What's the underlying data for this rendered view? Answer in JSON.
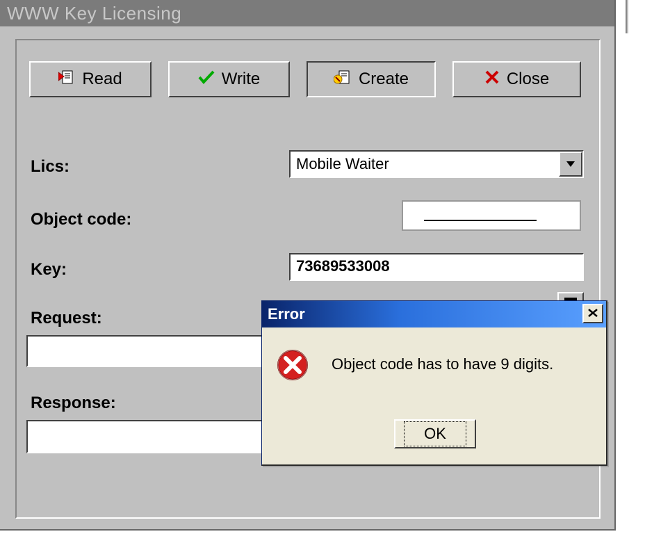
{
  "window": {
    "title": "WWW Key Licensing"
  },
  "toolbar": {
    "read_label": "Read",
    "write_label": "Write",
    "create_label": "Create",
    "close_label": "Close"
  },
  "fields": {
    "lics_label": "Lics:",
    "lics_value": "Mobile Waiter",
    "object_code_label": "Object code:",
    "object_code_value": "",
    "key_label": "Key:",
    "key_value": "73689533008",
    "request_label": "Request:",
    "request_value": "",
    "response_label": "Response:",
    "response_value": ""
  },
  "dialog": {
    "title": "Error",
    "message": "Object code has to have 9 digits.",
    "ok_label": "OK"
  }
}
